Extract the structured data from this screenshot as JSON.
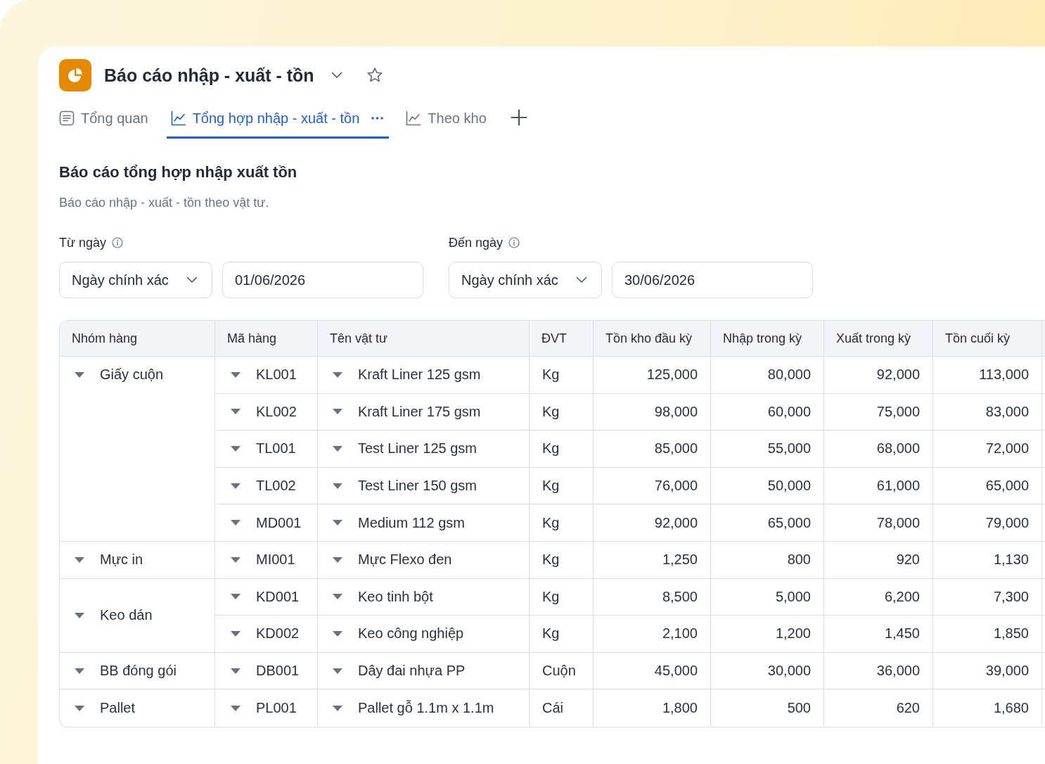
{
  "report": {
    "title": "Báo cáo nhập - xuất - tồn",
    "starred": false
  },
  "tabs": [
    {
      "label": "Tổng quan",
      "kind": "summary",
      "selected": false
    },
    {
      "label": "Tổng hợp nhập - xuất - tồn",
      "kind": "chart",
      "selected": true
    },
    {
      "label": "Theo kho",
      "kind": "chart",
      "selected": false
    }
  ],
  "section": {
    "title": "Báo cáo tổng hợp nhập xuất tồn",
    "subtitle": "Báo cáo nhập - xuất - tồn theo vật tư."
  },
  "filters": [
    {
      "label": "Từ ngày",
      "mode": "Ngày chính xác",
      "date": "01/06/2026"
    },
    {
      "label": "Đến ngày",
      "mode": "Ngày chính xác",
      "date": "30/06/2026"
    }
  ],
  "table": {
    "columns": [
      "Nhóm hàng",
      "Mã hàng",
      "Tên vật tư",
      "ĐVT",
      "Tồn kho đầu kỳ",
      "Nhập trong kỳ",
      "Xuất trong kỳ",
      "Tồn cuối kỳ"
    ],
    "groups": [
      {
        "name": "Giấy cuộn",
        "expanded": true,
        "items": [
          {
            "code": "KL001",
            "name": "Kraft Liner 125 gsm",
            "unit": "Kg",
            "expanded": true,
            "values": [
              "125,000",
              "80,000",
              "92,000",
              "113,000"
            ]
          },
          {
            "code": "KL002",
            "name": "Kraft Liner 175 gsm",
            "unit": "Kg",
            "expanded": true,
            "values": [
              "98,000",
              "60,000",
              "75,000",
              "83,000"
            ]
          },
          {
            "code": "TL001",
            "name": "Test Liner 125 gsm",
            "unit": "Kg",
            "expanded": true,
            "values": [
              "85,000",
              "55,000",
              "68,000",
              "72,000"
            ]
          },
          {
            "code": "TL002",
            "name": "Test Liner 150 gsm",
            "unit": "Kg",
            "expanded": true,
            "values": [
              "76,000",
              "50,000",
              "61,000",
              "65,000"
            ]
          },
          {
            "code": "MD001",
            "name": "Medium 112 gsm",
            "unit": "Kg",
            "expanded": true,
            "values": [
              "92,000",
              "65,000",
              "78,000",
              "79,000"
            ]
          }
        ]
      },
      {
        "name": "Mực in",
        "expanded": true,
        "items": [
          {
            "code": "MI001",
            "name": "Mực Flexo đen",
            "unit": "Kg",
            "expanded": true,
            "values": [
              "1,250",
              "800",
              "920",
              "1,130"
            ]
          }
        ]
      },
      {
        "name": "Keo dán",
        "expanded": true,
        "items": [
          {
            "code": "KD001",
            "name": "Keo tinh bột",
            "unit": "Kg",
            "expanded": true,
            "values": [
              "8,500",
              "5,000",
              "6,200",
              "7,300"
            ]
          },
          {
            "code": "KD002",
            "name": "Keo công nghiệp",
            "unit": "Kg",
            "expanded": true,
            "values": [
              "2,100",
              "1,200",
              "1,450",
              "1,850"
            ]
          }
        ]
      },
      {
        "name": "BB đóng gói",
        "expanded": true,
        "items": [
          {
            "code": "DB001",
            "name": "Dây đai nhựa PP",
            "unit": "Cuộn",
            "expanded": true,
            "values": [
              "45,000",
              "30,000",
              "36,000",
              "39,000"
            ]
          }
        ]
      },
      {
        "name": "Pallet",
        "expanded": true,
        "items": [
          {
            "code": "PL001",
            "name": "Pallet gỗ 1.1m x 1.1m",
            "unit": "Cái",
            "expanded": true,
            "values": [
              "1,800",
              "500",
              "620",
              "1,680"
            ]
          }
        ]
      }
    ]
  }
}
